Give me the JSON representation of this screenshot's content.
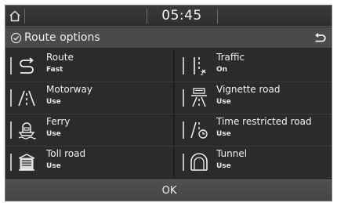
{
  "status": {
    "time": "05:45"
  },
  "title": "Route options",
  "options": [
    {
      "label": "Route",
      "value": "Fast",
      "icon": "route-icon"
    },
    {
      "label": "Traffic",
      "value": "On",
      "icon": "traffic-icon"
    },
    {
      "label": "Motorway",
      "value": "Use",
      "icon": "motorway-icon"
    },
    {
      "label": "Vignette road",
      "value": "Use",
      "icon": "vignette-road-icon"
    },
    {
      "label": "Ferry",
      "value": "Use",
      "icon": "ferry-icon"
    },
    {
      "label": "Time restricted road",
      "value": "Use",
      "icon": "time-restricted-road-icon"
    },
    {
      "label": "Toll road",
      "value": "Use",
      "icon": "toll-road-icon"
    },
    {
      "label": "Tunnel",
      "value": "Use",
      "icon": "tunnel-icon"
    }
  ],
  "ok_label": "OK"
}
